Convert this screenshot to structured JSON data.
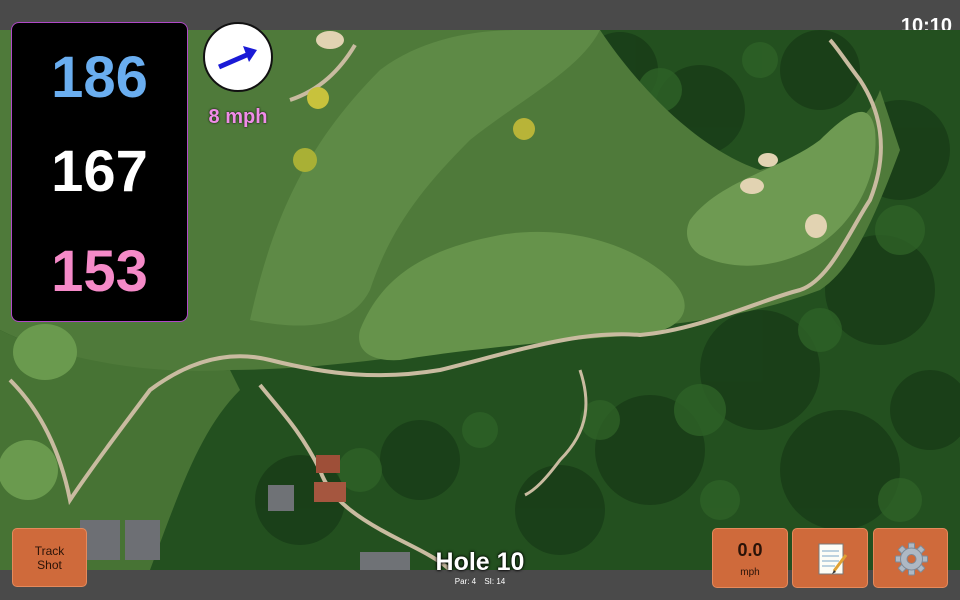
{
  "status": {
    "time": "10:10"
  },
  "distances": {
    "back": "186",
    "middle": "167",
    "front": "153"
  },
  "wind": {
    "speed": "8 mph",
    "icon": "arrow-icon",
    "direction": "north-east"
  },
  "buttons": {
    "track_shot": "Track Shot",
    "speed_value": "0.0",
    "speed_unit": "mph",
    "notes_icon": "notepad-icon",
    "settings_icon": "gear-icon"
  },
  "hole": {
    "title": "Hole 10",
    "par": "Par: 4",
    "si": "SI: 14"
  },
  "colors": {
    "back": "#6aaef0",
    "middle": "#ffffff",
    "front": "#f58ac8",
    "button": "#cf6a3b",
    "panel_border": "#b048c8"
  }
}
